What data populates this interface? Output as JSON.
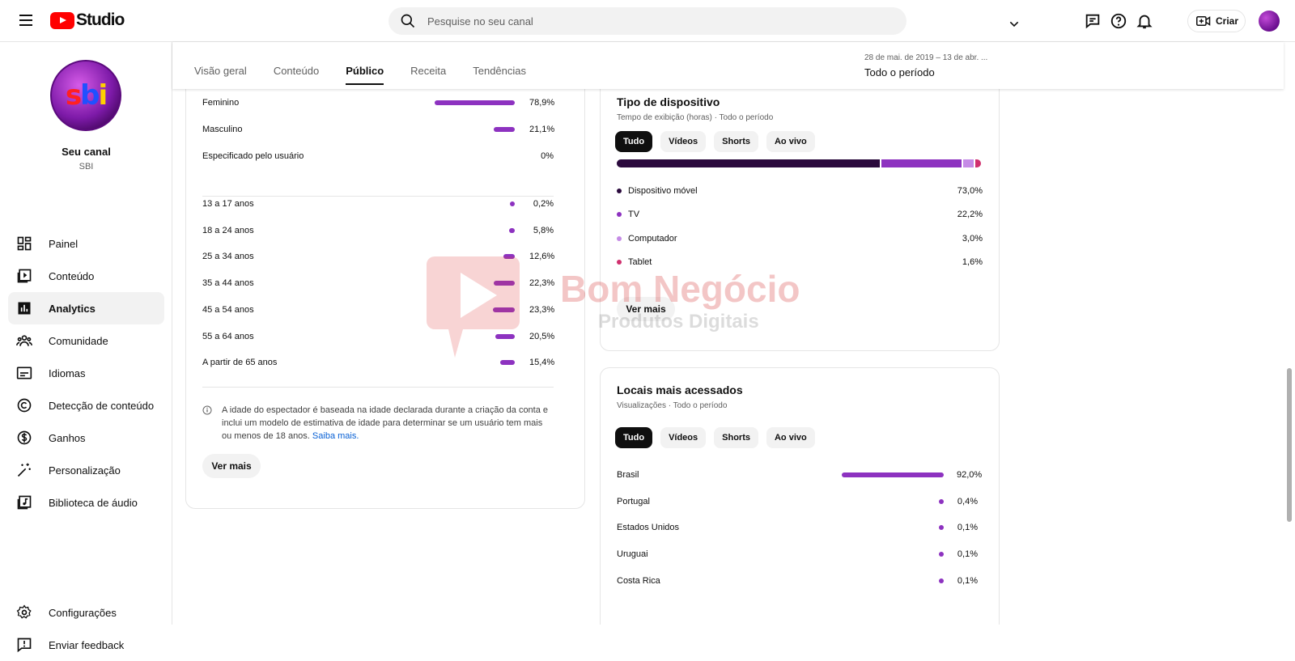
{
  "app": {
    "logo_text": "Studio"
  },
  "search": {
    "placeholder": "Pesquise no seu canal"
  },
  "header": {
    "create_label": "Criar"
  },
  "channel": {
    "name": "Seu canal",
    "handle": "SBI",
    "avatar_letters": [
      "s",
      "b",
      "i"
    ]
  },
  "nav": {
    "items": [
      {
        "label": "Painel",
        "icon": "dashboard-icon"
      },
      {
        "label": "Conteúdo",
        "icon": "content-icon"
      },
      {
        "label": "Analytics",
        "icon": "analytics-icon",
        "active": true
      },
      {
        "label": "Comunidade",
        "icon": "community-icon"
      },
      {
        "label": "Idiomas",
        "icon": "subtitles-icon"
      },
      {
        "label": "Detecção de conteúdo",
        "icon": "copyright-icon"
      },
      {
        "label": "Ganhos",
        "icon": "dollar-icon"
      },
      {
        "label": "Personalização",
        "icon": "magic-wand-icon"
      },
      {
        "label": "Biblioteca de áudio",
        "icon": "audio-library-icon"
      }
    ],
    "bottom": [
      {
        "label": "Configurações",
        "icon": "gear-icon"
      },
      {
        "label": "Enviar feedback",
        "icon": "feedback-icon"
      }
    ]
  },
  "tabs": [
    "Visão geral",
    "Conteúdo",
    "Público",
    "Receita",
    "Tendências"
  ],
  "active_tab": "Público",
  "period": {
    "range": "28 de mai. de 2019 – 13 de abr. ...",
    "label": "Todo o período"
  },
  "audience": {
    "gender": [
      {
        "label": "Feminino",
        "value": 78.9,
        "pct": "78,9%"
      },
      {
        "label": "Masculino",
        "value": 21.1,
        "pct": "21,1%"
      },
      {
        "label": "Especificado pelo usuário",
        "value": 0,
        "pct": "0%"
      }
    ],
    "age": [
      {
        "label": "13 a 17 anos",
        "value": 0.2,
        "pct": "0,2%"
      },
      {
        "label": "18 a 24 anos",
        "value": 5.8,
        "pct": "5,8%"
      },
      {
        "label": "25 a 34 anos",
        "value": 12.6,
        "pct": "12,6%"
      },
      {
        "label": "35 a 44 anos",
        "value": 22.3,
        "pct": "22,3%"
      },
      {
        "label": "45 a 54 anos",
        "value": 23.3,
        "pct": "23,3%"
      },
      {
        "label": "55 a 64 anos",
        "value": 20.5,
        "pct": "20,5%"
      },
      {
        "label": "A partir de 65 anos",
        "value": 15.4,
        "pct": "15,4%"
      }
    ],
    "info_text": "A idade do espectador é baseada na idade declarada durante a criação da conta e inclui um modelo de estimativa de idade para determinar se um usuário tem mais ou menos de 18 anos.",
    "info_link": "Saiba mais.",
    "more_label": "Ver mais"
  },
  "device": {
    "title": "Tipo de dispositivo",
    "subtitle": "Tempo de exibição (horas) · Todo o período",
    "chips": [
      "Tudo",
      "Vídeos",
      "Shorts",
      "Ao vivo"
    ],
    "items": [
      {
        "label": "Dispositivo móvel",
        "value": 73.0,
        "pct": "73,0%",
        "color": "#2b0a3d"
      },
      {
        "label": "TV",
        "value": 22.2,
        "pct": "22,2%",
        "color": "#8d32c0"
      },
      {
        "label": "Computador",
        "value": 3.0,
        "pct": "3,0%",
        "color": "#c58be6"
      },
      {
        "label": "Tablet",
        "value": 1.6,
        "pct": "1,6%",
        "color": "#d0306e"
      }
    ],
    "more_label": "Ver mais"
  },
  "locations": {
    "title": "Locais mais acessados",
    "subtitle": "Visualizações · Todo o período",
    "chips": [
      "Tudo",
      "Vídeos",
      "Shorts",
      "Ao vivo"
    ],
    "items": [
      {
        "label": "Brasil",
        "value": 92.0,
        "pct": "92,0%"
      },
      {
        "label": "Portugal",
        "value": 0.4,
        "pct": "0,4%"
      },
      {
        "label": "Estados Unidos",
        "value": 0.1,
        "pct": "0,1%"
      },
      {
        "label": "Uruguai",
        "value": 0.1,
        "pct": "0,1%"
      },
      {
        "label": "Costa Rica",
        "value": 0.1,
        "pct": "0,1%"
      }
    ]
  },
  "watermark": {
    "line1": "Bom Negócio",
    "line2": "Produtos Digitais"
  },
  "colors": {
    "accent": "#8d32c0",
    "brand_red": "#ff0000",
    "link": "#065fd4"
  }
}
